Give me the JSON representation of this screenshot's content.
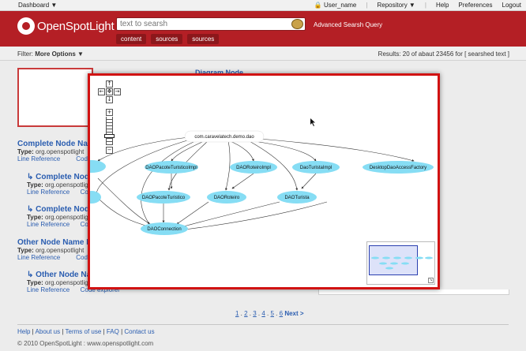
{
  "topbar": {
    "dashboard": "Dashboard ▼",
    "user": "User_name",
    "repository": "Repository ▼",
    "help": "Help",
    "preferences": "Preferences",
    "logout": "Logout"
  },
  "header": {
    "logo_text": "OpenSpotLight",
    "search_placeholder": "text to searsh",
    "advanced": "Advanced Searsh Query",
    "tabs": [
      "content",
      "sources",
      "sources"
    ]
  },
  "filterbar": {
    "filter_label": "Filter:",
    "filter_value": "More Options ▼",
    "results": "Results: 20 of abaut 23456 for [ searshed text ]"
  },
  "results": {
    "bg_title": "Diagram Node",
    "items": [
      {
        "title": "Complete Node Name",
        "type_label": "Type:",
        "type_value": "org.openspotlight",
        "link1": "Line Reference",
        "link2": "Code"
      },
      {
        "title": "Complete Node N",
        "type_label": "Type:",
        "type_value": "org.openspotlight",
        "link1": "Line Reference",
        "link2": "Code"
      },
      {
        "title": "Complete Node N",
        "type_label": "Type:",
        "type_value": "org.openspotlight",
        "link1": "Line Reference",
        "link2": "Code"
      },
      {
        "title": "Other Node Name He",
        "type_label": "Type:",
        "type_value": "org.openspotlight",
        "link1": "Line Reference",
        "link2": "Code"
      },
      {
        "title": "Other Node Name",
        "type_label": "Type:",
        "type_value": "org.openspotlight",
        "link1": "Line Reference",
        "link2": "Code explorer"
      }
    ]
  },
  "pager": {
    "pages": [
      "1",
      "2",
      "3",
      "4",
      "5",
      "6"
    ],
    "next": "Next >"
  },
  "footer": {
    "links": [
      "Help",
      "About us",
      "Terms of use",
      "FAQ",
      "Contact us"
    ],
    "copyright": "© 2010 OpenSpotLight : www.openspotlight.com"
  },
  "diagram": {
    "root": "com.caravelatech.demo.dao",
    "nodes": {
      "n1": "DAOPacoteTuristicoImpl",
      "n2": "DAORoteiroImpl",
      "n3": "DaoTuristaImpl",
      "n4": "DesktopDaoAccessFactory",
      "n5": "DAOPacoteTuristico",
      "n6": "DAORoteiro",
      "n7": "DAOTurista",
      "n8": "DAOConnection"
    },
    "zoom_controls": {
      "up": "↑",
      "left": "←",
      "center": "✥",
      "right": "→",
      "down": "↓",
      "zoom_in": "+",
      "zoom_out": "−"
    },
    "node_color": "#86ddf4",
    "minimap_corner": "↘"
  }
}
